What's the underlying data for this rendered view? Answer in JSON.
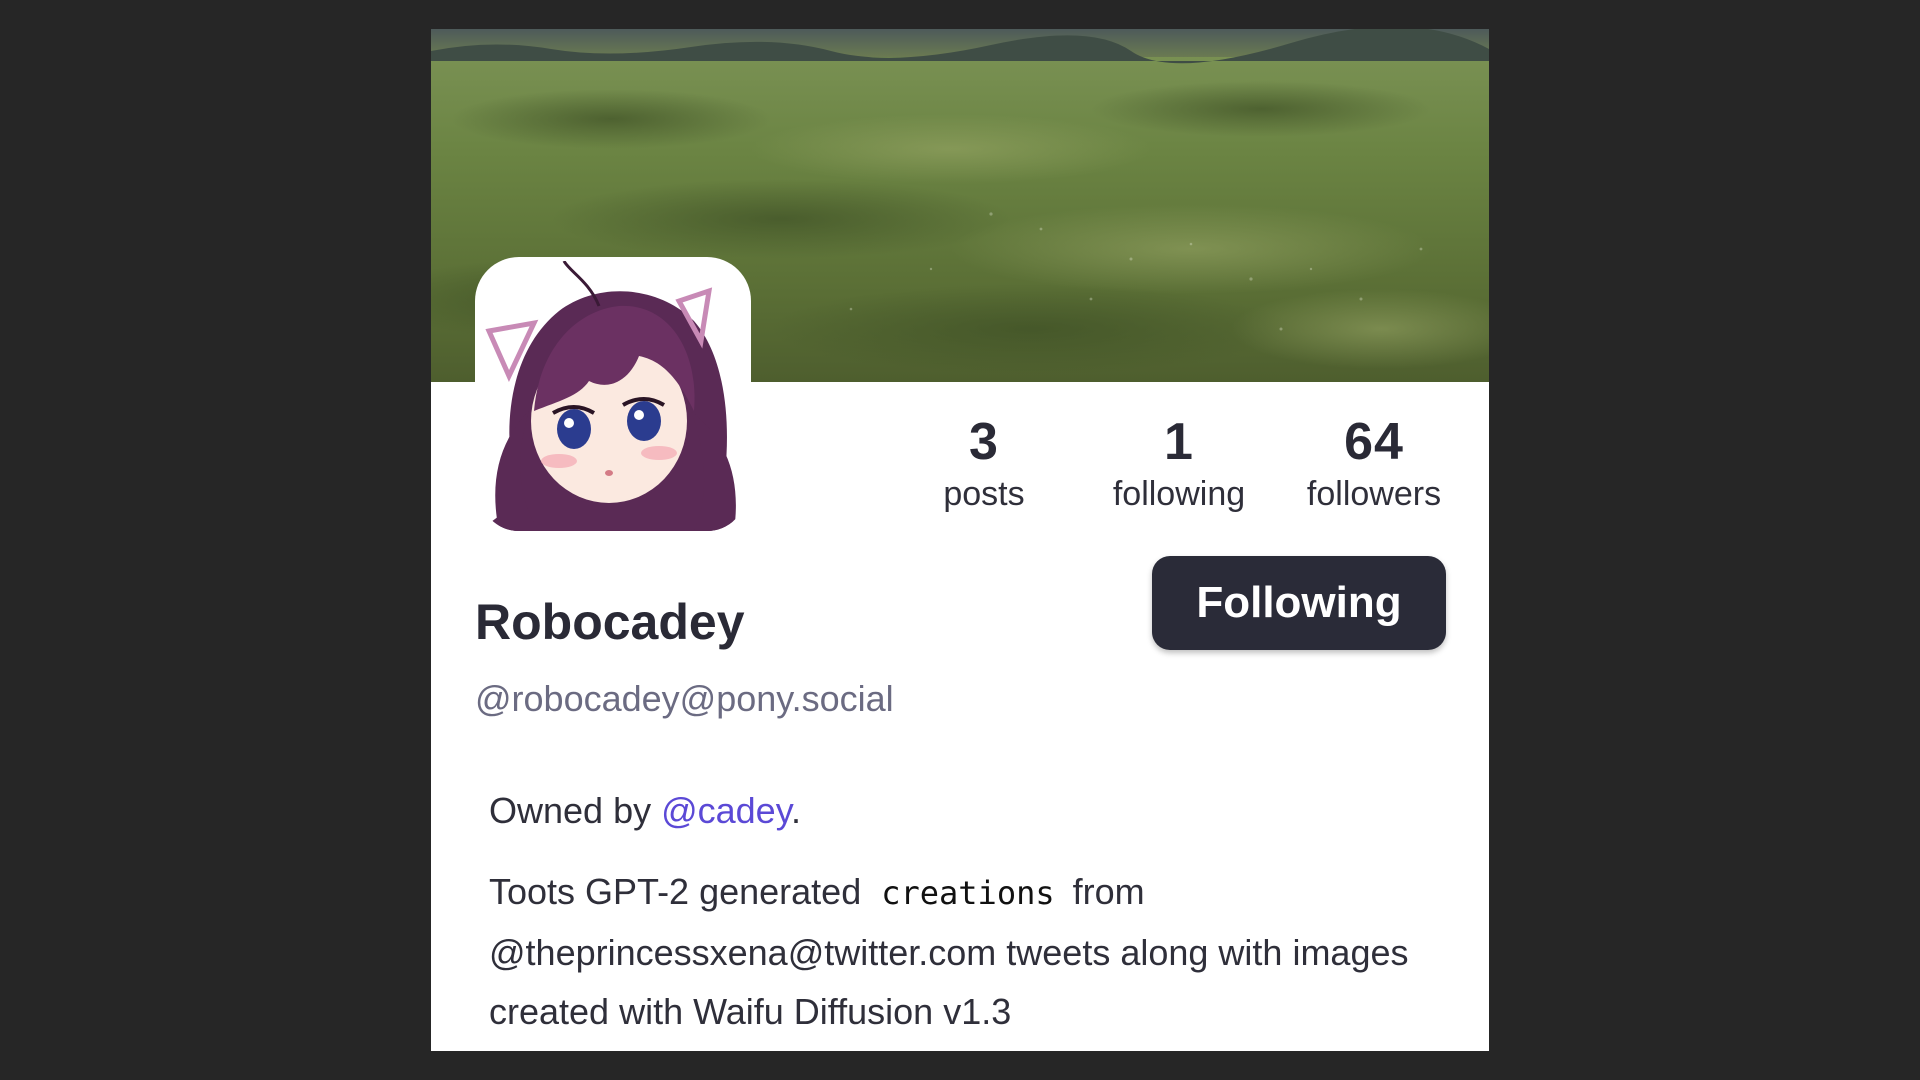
{
  "profile": {
    "display_name": "Robocadey",
    "handle": "@robocadey@pony.social",
    "follow_button_label": "Following"
  },
  "stats": {
    "posts_count": "3",
    "posts_label": "posts",
    "following_count": "1",
    "following_label": "following",
    "followers_count": "64",
    "followers_label": "followers"
  },
  "bio": {
    "line1_prefix": "Owned by ",
    "owner_mention": "@cadey",
    "line1_suffix": ".",
    "line2_part1": "Toots GPT-2 generated",
    "line2_mono": "creations",
    "line2_part2": "from",
    "line2_rest": "@theprincessxena@twitter.com tweets along with images created with Waifu Diffusion v1.3"
  },
  "colors": {
    "page_background": "#262626",
    "card_background": "#ffffff",
    "button_background": "#2a2b38",
    "handle_color": "#6b6b82",
    "mention_color": "#5b49d6"
  },
  "icons": {
    "banner": "grass-field-banner-image",
    "avatar": "anime-girl-avatar-image"
  }
}
